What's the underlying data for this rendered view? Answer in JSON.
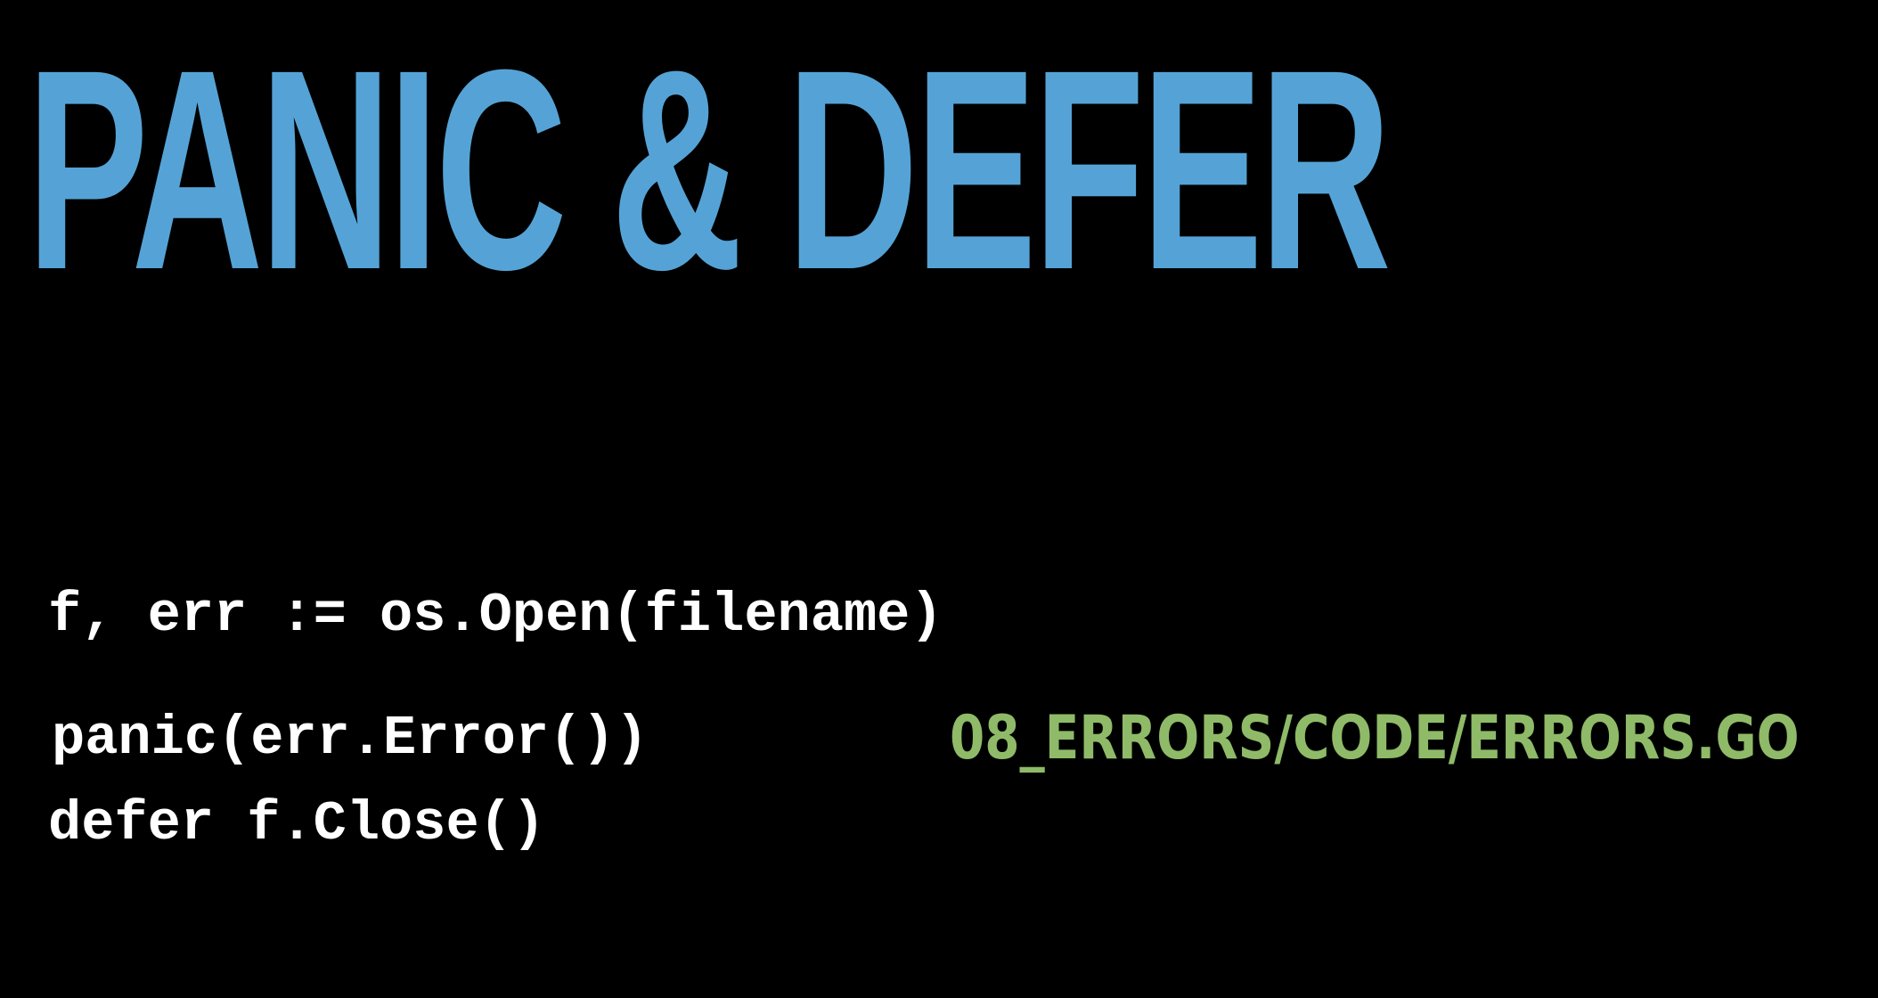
{
  "slide": {
    "title": "PANIC & DEFER",
    "code_lines": [
      "f, err := os.Open(filename)",
      "defer f.Close()"
    ],
    "panic_line": "panic(err.Error())",
    "file_path": "08_ERRORS/CODE/ERRORS.GO",
    "colors": {
      "background": "#000000",
      "title": "#55a3d6",
      "code": "#ffffff",
      "file_path": "#8fba68"
    }
  }
}
